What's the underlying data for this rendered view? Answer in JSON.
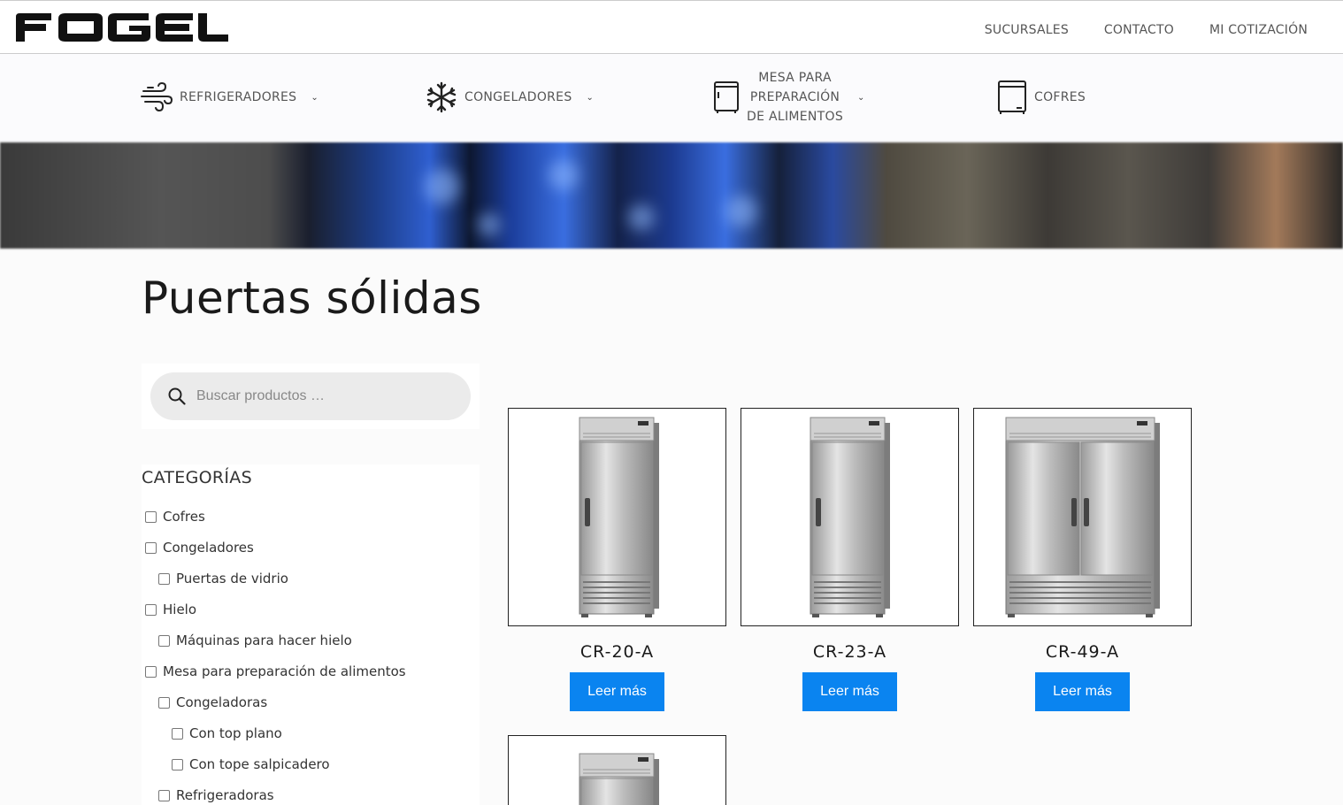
{
  "brand": {
    "logo_text": "FOGEL"
  },
  "top_nav": [
    {
      "label": "SUCURSALES"
    },
    {
      "label": "CONTACTO"
    },
    {
      "label": "MI COTIZACIÓN"
    }
  ],
  "category_nav": [
    {
      "label": "REFRIGERADORES",
      "icon": "wind-icon",
      "has_dropdown": true
    },
    {
      "label": "CONGELADORES",
      "icon": "snowflake-icon",
      "has_dropdown": true
    },
    {
      "label_lines": [
        "MESA PARA",
        "PREPARACIÓN",
        "DE ALIMENTOS"
      ],
      "icon": "prep-table-icon",
      "has_dropdown": true
    },
    {
      "label": "COFRES",
      "icon": "chest-freezer-icon",
      "has_dropdown": false
    }
  ],
  "page": {
    "title": "Puertas sólidas"
  },
  "search": {
    "placeholder": "Buscar productos …"
  },
  "categories": {
    "title": "CATEGORÍAS",
    "items": [
      {
        "label": "Cofres",
        "level": 0
      },
      {
        "label": "Congeladores",
        "level": 0
      },
      {
        "label": "Puertas de vidrio",
        "level": 1
      },
      {
        "label": "Hielo",
        "level": 0
      },
      {
        "label": "Máquinas para hacer hielo",
        "level": 1
      },
      {
        "label": "Mesa para preparación de alimentos",
        "level": 0
      },
      {
        "label": "Congeladoras",
        "level": 1
      },
      {
        "label": "Con top plano",
        "level": 2
      },
      {
        "label": "Con tope salpicadero",
        "level": 2
      },
      {
        "label": "Refrigeradoras",
        "level": 1
      }
    ]
  },
  "products": [
    {
      "name": "CR-20-A",
      "button": "Leer más",
      "doors": 1
    },
    {
      "name": "CR-23-A",
      "button": "Leer más",
      "doors": 1
    },
    {
      "name": "CR-49-A",
      "button": "Leer más",
      "doors": 2
    },
    {
      "name": "",
      "button": "",
      "doors": 1
    }
  ],
  "colors": {
    "accent": "#0a84f0"
  }
}
